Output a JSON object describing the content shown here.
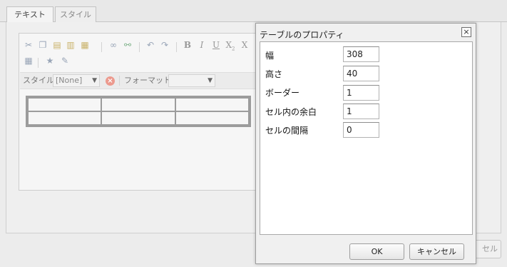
{
  "tabs": [
    {
      "label": "テキスト",
      "active": true
    },
    {
      "label": "スタイル",
      "active": false
    }
  ],
  "editor": {
    "toolbar_icons": [
      "cut-icon",
      "copy-icon",
      "paste-icon",
      "paste-text-icon",
      "paste-word-icon",
      "link-icon",
      "unlink-icon",
      "undo-icon",
      "redo-icon",
      "bold-icon",
      "italic-icon",
      "underline-icon",
      "subscript-icon",
      "superscript-icon",
      "table-icon",
      "special-char-icon",
      "source-edit-icon"
    ],
    "style_label": "スタイル",
    "style_value": "[None]",
    "format_label": "フォーマット",
    "format_value": ""
  },
  "bg_cancel_label": "セル",
  "dialog": {
    "title": "テーブルのプロパティ",
    "fields": [
      {
        "label": "幅",
        "value": "308"
      },
      {
        "label": "高さ",
        "value": "40"
      },
      {
        "label": "ボーダー",
        "value": "1"
      },
      {
        "label": "セル内の余白",
        "value": "1"
      },
      {
        "label": "セルの間隔",
        "value": "0"
      }
    ],
    "ok_label": "OK",
    "cancel_label": "キャンセル"
  }
}
